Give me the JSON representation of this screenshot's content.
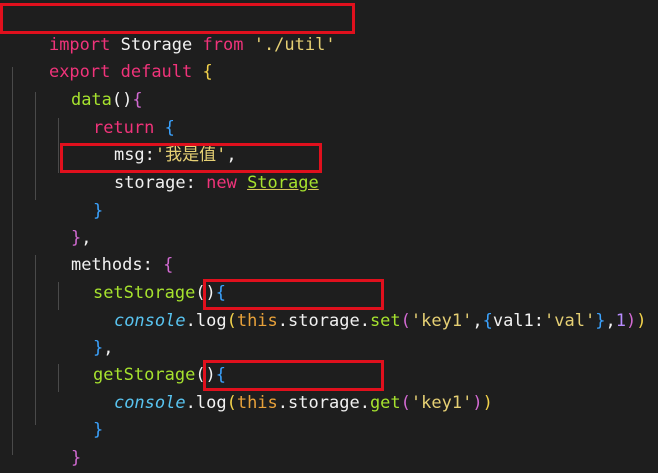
{
  "code": {
    "line1": {
      "import_kw": "import",
      "ident": " Storage ",
      "from_kw": "from",
      "space": " ",
      "path": "'./util'"
    },
    "line2": {
      "export_kw": "export",
      "default_kw": " default",
      "brace": " {"
    },
    "line3": {
      "data_fn": "data",
      "parens": "()",
      "brace": "{"
    },
    "line4": {
      "return_kw": "return",
      "brace": " {"
    },
    "line5": {
      "key": "msg",
      "colon": ":",
      "value": "'我是值'",
      "comma": ","
    },
    "line6": {
      "key": "storage",
      "colon": ": ",
      "new_kw": "new",
      "space": " ",
      "class_name": "Storage"
    },
    "line7": {
      "brace": "}"
    },
    "line8": {
      "brace": "}",
      "comma": ","
    },
    "line9": {
      "key": "methods",
      "colon": ": ",
      "brace": "{"
    },
    "line10": {
      "fn": "setStorage",
      "parens": "()",
      "brace": "{"
    },
    "line11": {
      "console": "console",
      "dot1": ".",
      "log": "log",
      "open": "(",
      "this": "this",
      "dot2": ".",
      "storage": "storage",
      "dot3": ".",
      "method": "set",
      "args_open": "(",
      "arg1": "'key1'",
      "comma1": ",",
      "obj_open": "{",
      "obj_key": "val1",
      "obj_colon": ":",
      "obj_val": "'val'",
      "obj_close": "}",
      "comma2": ",",
      "num": "1",
      "args_close": ")",
      "close": ")"
    },
    "line12": {
      "brace": "}",
      "comma": ","
    },
    "line13": {
      "fn": "getStorage",
      "parens": "()",
      "brace": "{"
    },
    "line14": {
      "console": "console",
      "dot1": ".",
      "log": "log",
      "open": "(",
      "this": "this",
      "dot2": ".",
      "storage": "storage",
      "dot3": ".",
      "method": "get",
      "args_open": "(",
      "arg1": "'key1'",
      "args_close": ")",
      "close": ")"
    },
    "line15": {
      "brace": "}"
    },
    "line16": {
      "brace": "}"
    },
    "line17": {
      "brace": "}"
    }
  },
  "colors": {
    "background": "#1e1e1e",
    "highlight_border": "#e0101d",
    "keyword_pink": "#f0337a",
    "keyword_orange": "#e8a13a",
    "string": "#e6d074",
    "function": "#a6e22e",
    "italic_builtin": "#59c4f0"
  }
}
